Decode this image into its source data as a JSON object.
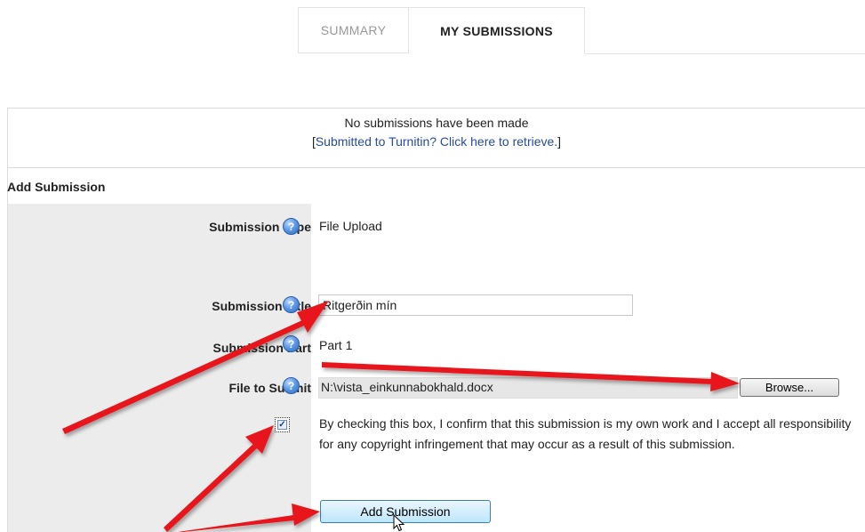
{
  "tabs": [
    {
      "label": "SUMMARY",
      "active": false
    },
    {
      "label": "MY SUBMISSIONS",
      "active": true
    }
  ],
  "notice": {
    "message": "No submissions have been made",
    "link_prefix": "[",
    "link_text": "Submitted to Turnitin? Click here to retrieve.",
    "link_suffix": "]"
  },
  "form": {
    "title": "Add Submission",
    "help_glyph": "?",
    "fields": {
      "type_label": "Submission Type",
      "type_value": "File Upload",
      "title_label": "Submission Title",
      "title_value": "Ritgerðin mín",
      "part_label": "Submission Part",
      "part_value": "Part 1",
      "file_label": "File to Submit",
      "file_value": "N:\\vista_einkunnabokhald.docx",
      "browse_label": "Browse..."
    },
    "agree": {
      "checked": true,
      "text": "By checking this box, I confirm that this submission is my own work and I accept all responsibility for any copyright infringement that may occur as a result of this submission."
    },
    "submit_label": "Add Submission"
  },
  "colors": {
    "annotation_arrow": "#e8171a",
    "link": "#2a4b9a",
    "label_column_bg": "#ececec"
  }
}
